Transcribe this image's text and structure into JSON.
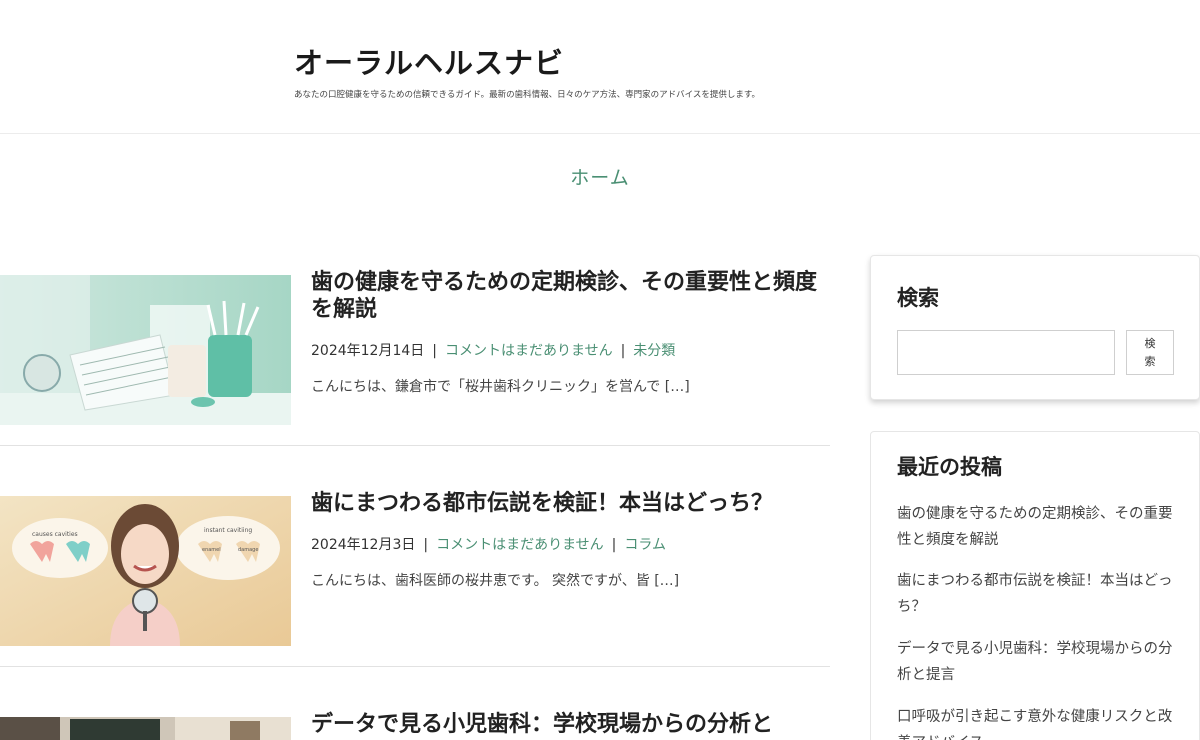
{
  "header": {
    "site_title": "オーラルヘルスナビ",
    "site_description": "あなたの口腔健康を守るための信頼できるガイド。最新の歯科情報、日々のケア方法、専門家のアドバイスを提供します。"
  },
  "nav": {
    "home_label": "ホーム"
  },
  "posts": [
    {
      "title": "歯の健康を守るための定期検診、その重要性と頻度を解説",
      "date": "2024年12月14日",
      "comments": "コメントはまだありません",
      "category": "未分類",
      "excerpt": "こんにちは、鎌倉市で「桜井歯科クリニック」を営んで […]"
    },
    {
      "title": "歯にまつわる都市伝説を検証！本当はどっち？",
      "date": "2024年12月3日",
      "comments": "コメントはまだありません",
      "category": "コラム",
      "excerpt": "こんにちは、歯科医師の桜井恵です。 突然ですが、皆 […]",
      "image_labels": {
        "left_bubble": "causes cavities",
        "right_bubble": "instant cavitiing",
        "tooth_left": "enamel",
        "tooth_right": "damage"
      }
    },
    {
      "title": "データで見る小児歯科：学校現場からの分析と"
    }
  ],
  "sidebar": {
    "search": {
      "title": "検索",
      "button_label": "検索",
      "input_value": ""
    },
    "recent": {
      "title": "最近の投稿",
      "items": [
        "歯の健康を守るための定期検診、その重要性と頻度を解説",
        "歯にまつわる都市伝説を検証！本当はどっち？",
        "データで見る小児歯科：学校現場からの分析と提言",
        "口呼吸が引き起こす意外な健康リスクと改善アドバイス"
      ]
    }
  }
}
